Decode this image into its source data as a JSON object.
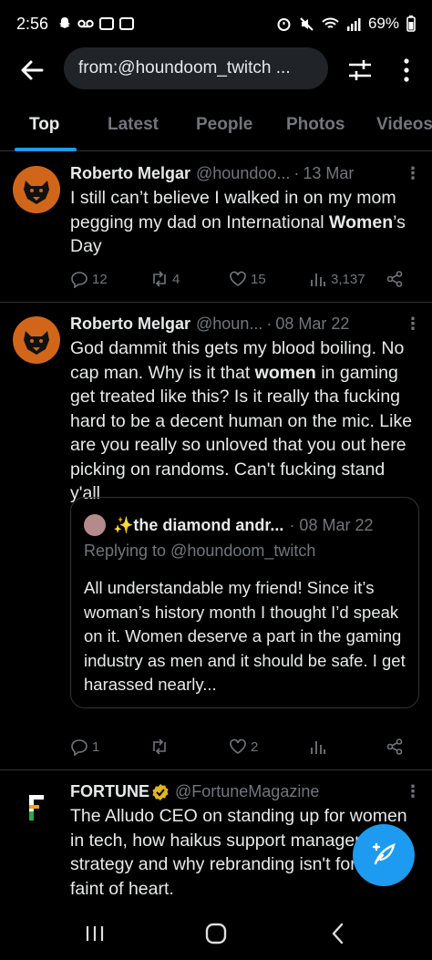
{
  "status_bar": {
    "time": "2:56",
    "battery": "69%"
  },
  "search": {
    "query": "from:@houndoom_twitch ..."
  },
  "tabs": [
    {
      "label": "Top",
      "active": true
    },
    {
      "label": "Latest"
    },
    {
      "label": "People"
    },
    {
      "label": "Photos"
    },
    {
      "label": "Videos"
    }
  ],
  "tweets": [
    {
      "name": "Roberto Melgar",
      "handle": "@houndoo...",
      "date": "13 Mar",
      "text_before": "I still can’t believe I walked in on my mom pegging my dad on International ",
      "text_bold": "Women",
      "text_after": "’s Day",
      "stats": {
        "replies": "12",
        "retweets": "4",
        "likes": "15",
        "views": "3,137"
      }
    },
    {
      "name": "Roberto Melgar",
      "handle": "@houn...",
      "date": "08 Mar 22",
      "text_before": "God dammit this gets my blood boiling. No cap man. Why is it that ",
      "text_bold": "women",
      "text_after": " in gaming get treated like this? Is it really tha fucking hard to be a decent human on the mic. Like are you really so unloved that you out here picking on randoms. Can't fucking stand y'all",
      "quote": {
        "name": "✨the diamond andr...",
        "date": "· 08 Mar 22",
        "replying": "Replying to @houndoom_twitch",
        "text": "All understandable my friend! Since it’s woman’s history month I thought I’d speak on it. Women deserve a part in the gaming industry as men and it should be safe. I get harassed nearly..."
      },
      "stats": {
        "replies": "1",
        "retweets": "",
        "likes": "2",
        "views": ""
      }
    },
    {
      "name": "FORTUNE",
      "handle": "@FortuneMagazine",
      "text": "The Alludo CEO on standing up for women in tech, how haikus support management strategy and why rebranding isn't for the faint of heart."
    }
  ],
  "colors": {
    "accent": "#1d9bf0",
    "muted": "#71767b",
    "text": "#e7e9ea",
    "border": "#2f3336",
    "verified": "#e2b719"
  }
}
